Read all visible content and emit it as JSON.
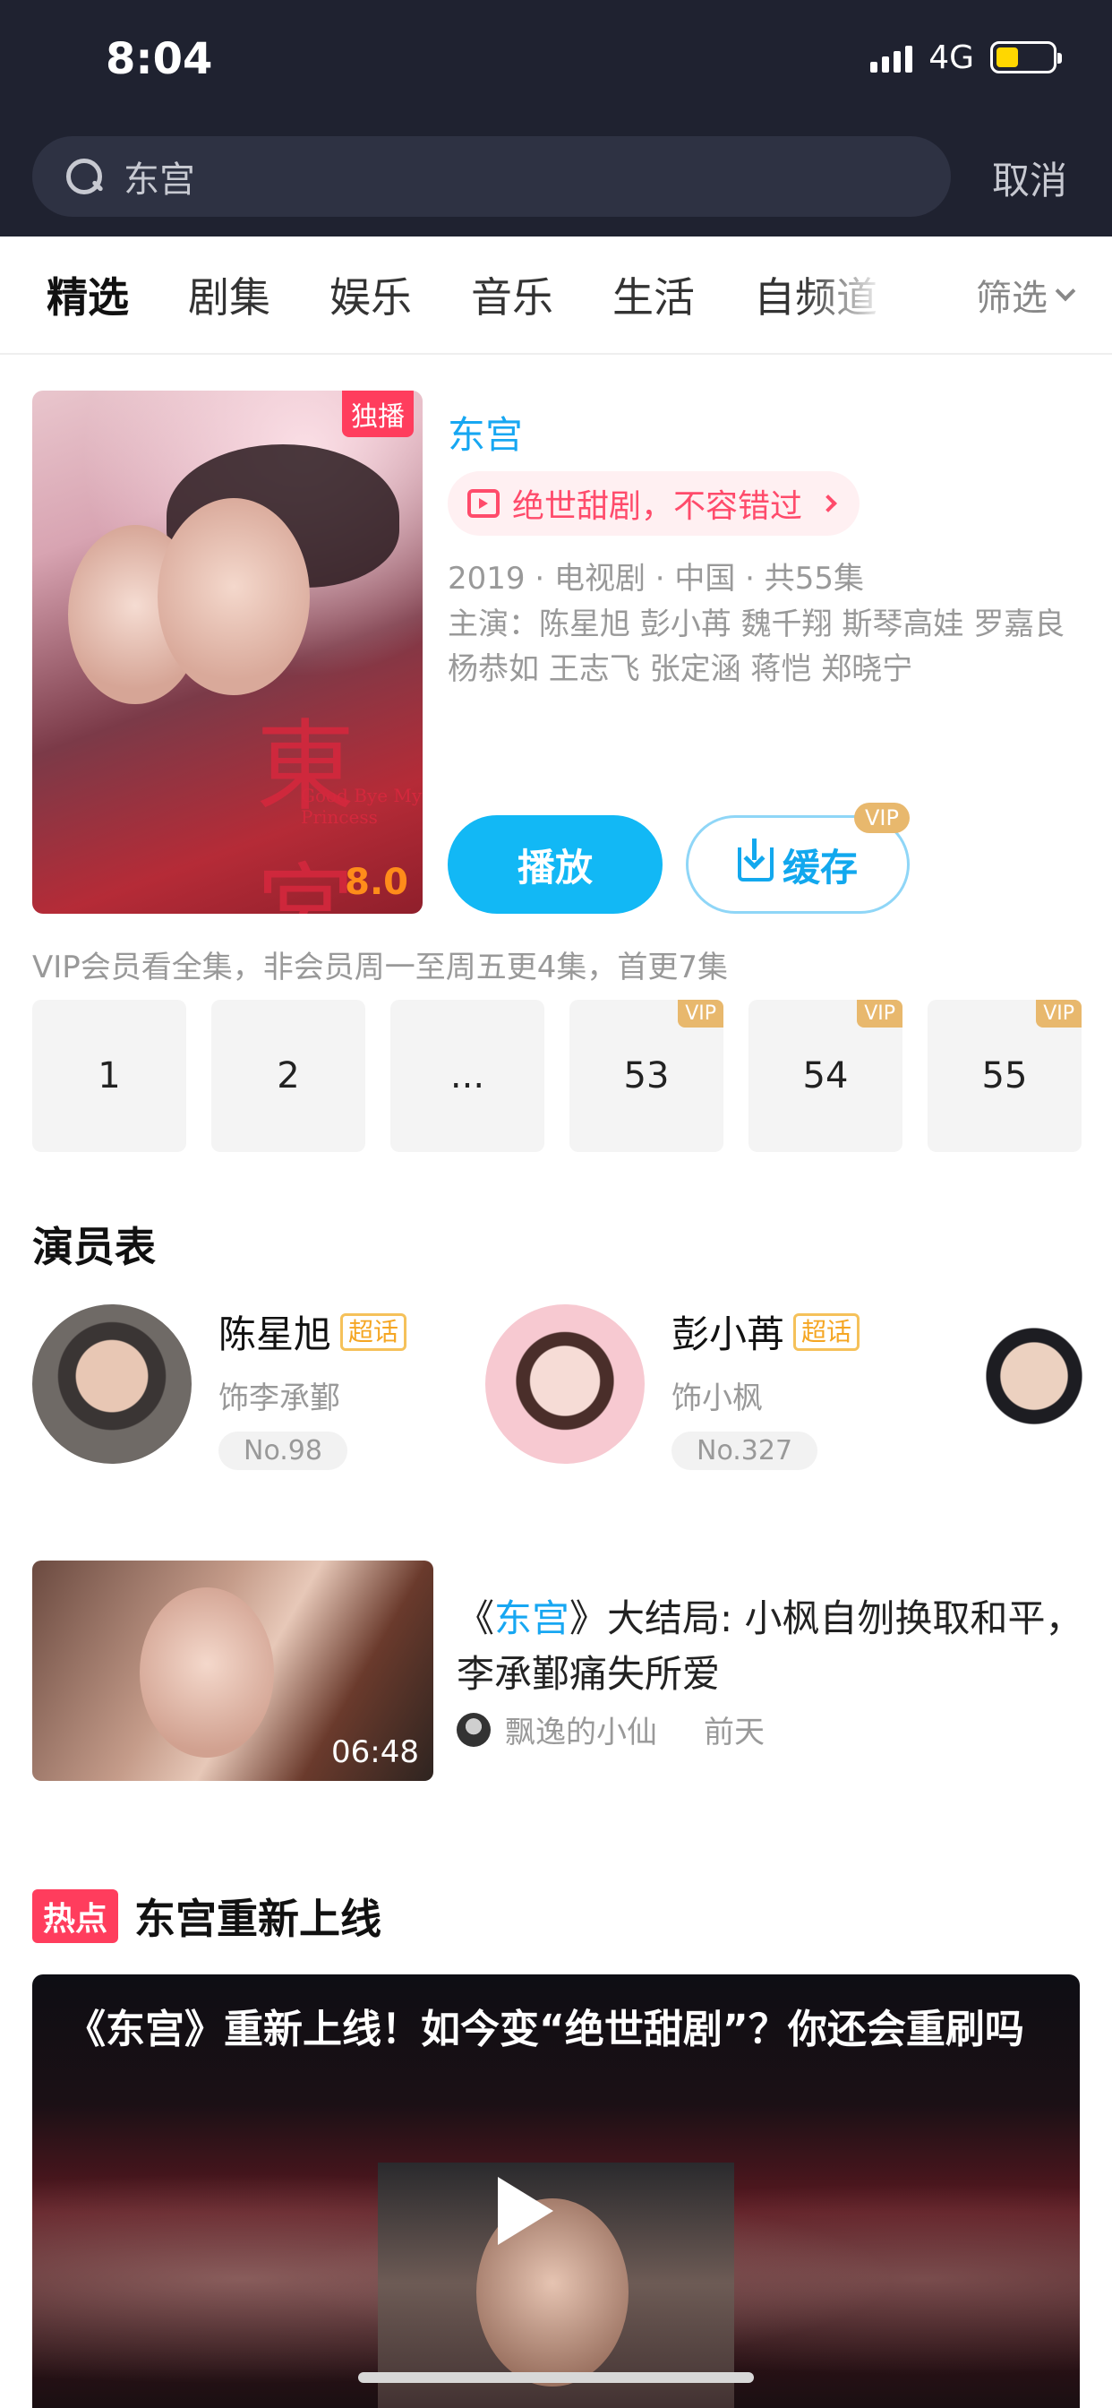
{
  "status_bar": {
    "time": "8:04",
    "network": "4G"
  },
  "search": {
    "query": "东宫",
    "cancel_label": "取消"
  },
  "tabs": [
    {
      "label": "精选"
    },
    {
      "label": "剧集"
    },
    {
      "label": "娱乐"
    },
    {
      "label": "音乐"
    },
    {
      "label": "生活"
    },
    {
      "label": "自频道"
    }
  ],
  "filter_label": "筛选",
  "show": {
    "badge": "独播",
    "rating": "8.0",
    "poster_glyph": "東宮",
    "poster_subtitle": "Good Bye My Princess",
    "title": "东宫",
    "slogan": "绝世甜剧，不容错过",
    "meta": "2019 · 电视剧 · 中国 · 共55集",
    "cast_line": "主演：陈星旭 彭小苒 魏千翔 斯琴高娃 罗嘉良 杨恭如 王志飞 张定涵 蒋恺 郑晓宁",
    "play_label": "播放",
    "cache_label": "缓存",
    "cache_vip": "VIP",
    "notice": "VIP会员看全集，非会员周一至周五更4集，首更7集",
    "episodes": [
      {
        "label": "1",
        "vip": ""
      },
      {
        "label": "2",
        "vip": ""
      },
      {
        "label": "...",
        "vip": ""
      },
      {
        "label": "53",
        "vip": "VIP"
      },
      {
        "label": "54",
        "vip": "VIP"
      },
      {
        "label": "55",
        "vip": "VIP"
      }
    ]
  },
  "cast_section": {
    "title": "演员表",
    "actors": [
      {
        "name": "陈星旭",
        "tag": "超话",
        "role": "饰李承鄞",
        "rank": "No.98"
      },
      {
        "name": "彭小苒",
        "tag": "超话",
        "role": "饰小枫",
        "rank": "No.327"
      }
    ]
  },
  "video": {
    "duration": "06:48",
    "title_prefix": "《",
    "title_highlight": "东宫",
    "title_suffix": "》大结局: 小枫自刎换取和平，李承鄞痛失所爱",
    "author": "飘逸的小仙",
    "time": "前天"
  },
  "hot": {
    "label": "热点",
    "title": "东宫重新上线",
    "card_title": "《东宫》重新上线！如今变“绝世甜剧”？你还会重刷吗"
  }
}
